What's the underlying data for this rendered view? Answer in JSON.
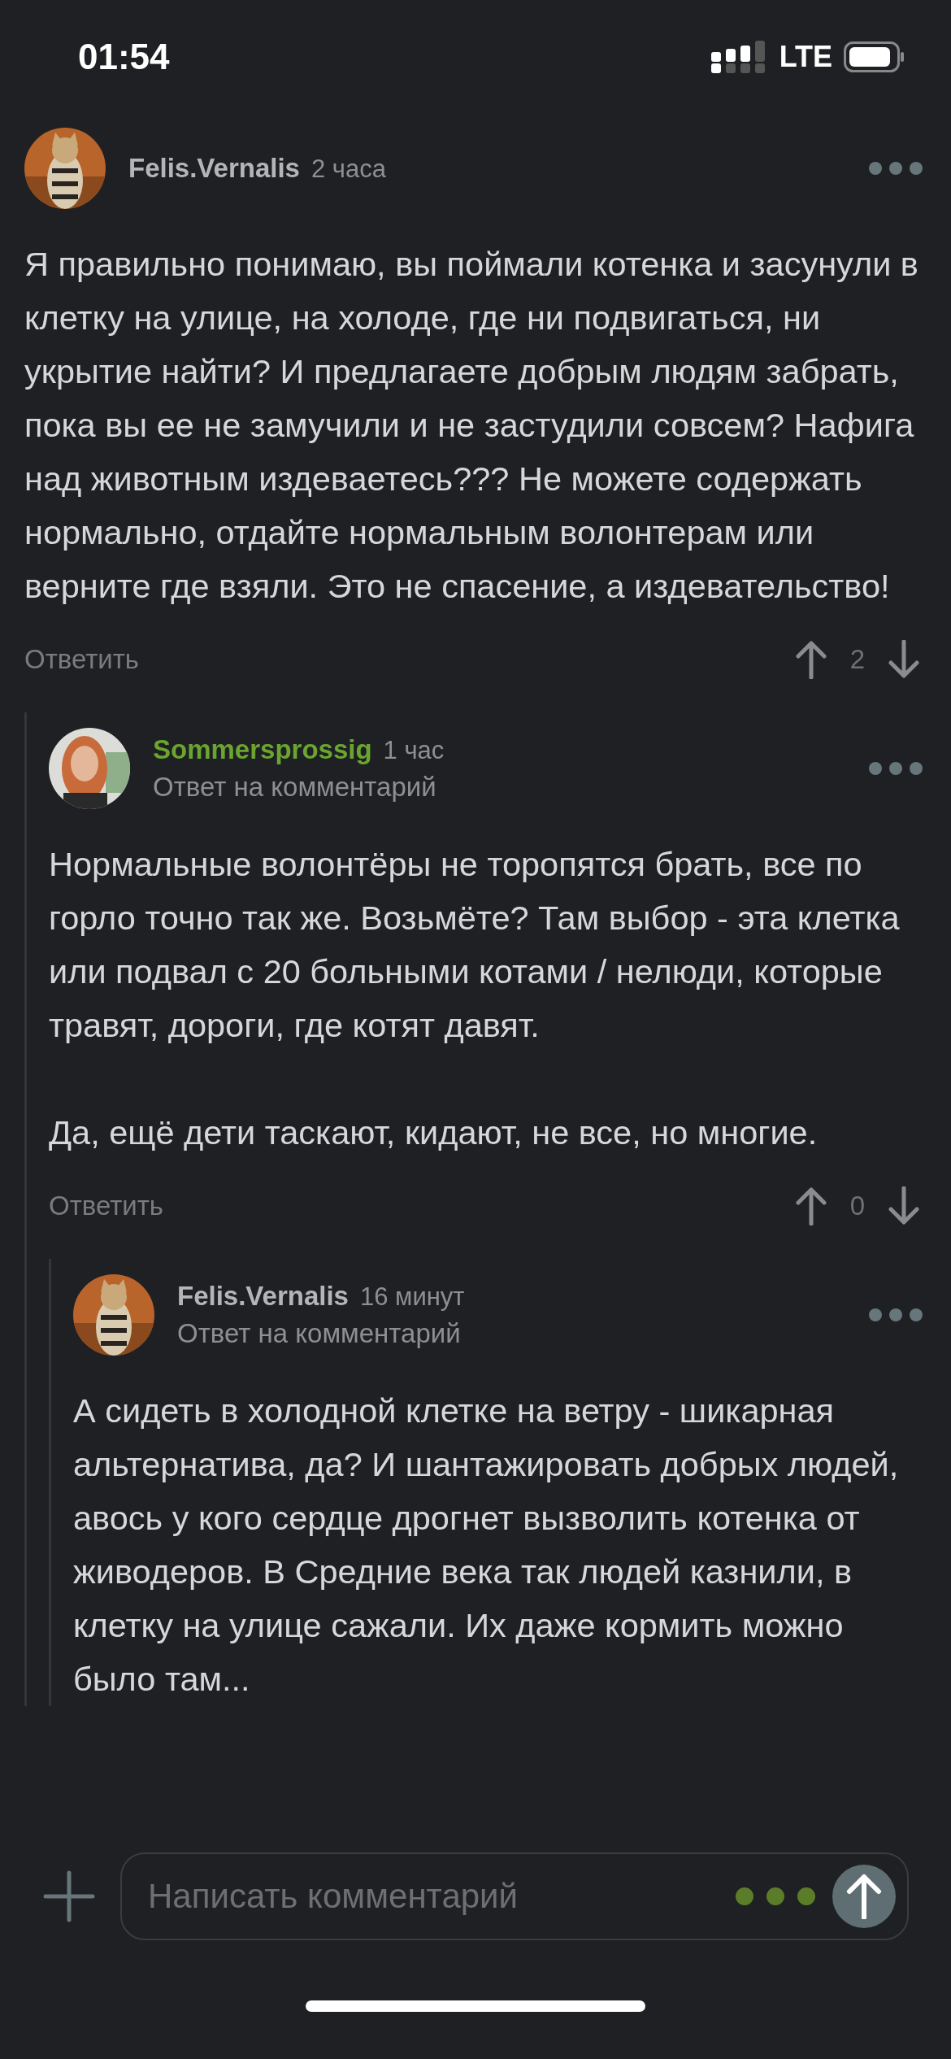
{
  "status_bar": {
    "time": "01:54",
    "network": "LTE"
  },
  "comments": [
    {
      "author": "Felis.Vernalis",
      "color": "#b4b5b6",
      "time": "2 часа",
      "paragraphs": [
        "Я правильно понимаю, вы поймали котенка и засунули в клетку на улице, на холоде, где ни подвигаться, ни укрытие найти? И предлагаете добрым людям забрать, пока вы ее не замучили и не застудили совсем? Нафига над животным издеваетесь??? Не можете содержать нормально, отдайте нормальным волонтерам или верните где взяли. Это не спасение, а издевательство!"
      ],
      "reply_label": "Ответить",
      "score": "2",
      "children": [
        {
          "author": "Sommersprossig",
          "color": "#6ba52f",
          "time": "1 час",
          "reply_to": "Ответ на комментарий",
          "paragraphs": [
            "Нормальные волонтёры не торопятся брать, все по горло точно так же. Возьмёте? Там выбор - эта клетка или подвал с 20 больными котами / нелюди, которые травят, дороги, где котят давят.",
            "Да, ещё дети таскают, кидают, не все, но многие."
          ],
          "reply_label": "Ответить",
          "score": "0",
          "children": [
            {
              "author": "Felis.Vernalis",
              "color": "#b4b5b6",
              "time": "16 минут",
              "reply_to": "Ответ на комментарий",
              "paragraphs": [
                "А сидеть в холодной клетке на ветру - шикарная альтернатива, да? И шантажировать добрых людей, авось у кого сердце дрогнет вызволить котенка от живодеров. В Средние века так людей казнили, в клетку на улице сажали. Их даже кормить можно было там..."
              ]
            }
          ]
        }
      ]
    }
  ],
  "composer": {
    "placeholder": "Написать комментарий"
  }
}
